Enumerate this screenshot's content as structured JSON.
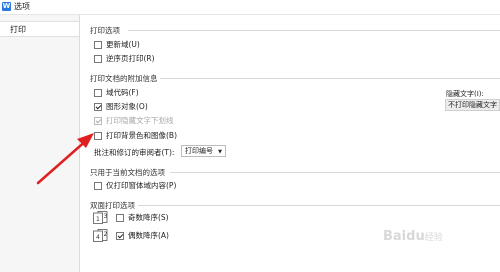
{
  "window": {
    "title": "选项",
    "app_icon": "W"
  },
  "sidebar": {
    "items": [
      {
        "label": "打印"
      }
    ]
  },
  "sections": {
    "print_options": {
      "title": "打印选项",
      "items": [
        {
          "label": "更新域(U)",
          "checked": false
        },
        {
          "label": "逆序页打印(R)",
          "checked": false
        }
      ]
    },
    "attached_info": {
      "title": "打印文档的附加信息",
      "items": [
        {
          "label": "域代码(F)",
          "checked": false,
          "disabled": false
        },
        {
          "label": "图形对象(O)",
          "checked": true,
          "disabled": false
        },
        {
          "label": "打印隐藏文字下划线",
          "checked": true,
          "disabled": true
        },
        {
          "label": "打印背景色和图像(B)",
          "checked": false,
          "disabled": false
        }
      ],
      "hidden_text_label": "隐藏文字(I):",
      "hidden_text_value": "不打印隐藏文字",
      "reviewer_label": "批注和修订的审阅者(T):",
      "reviewer_value": "打印编号"
    },
    "current_doc": {
      "title": "只用于当前文档的选项",
      "items": [
        {
          "label": "仅打印窗体域内容(P)",
          "checked": false
        }
      ]
    },
    "duplex": {
      "title": "双面打印选项",
      "items": [
        {
          "label": "奇数降序(S)",
          "checked": false,
          "icon_pages": "1 3"
        },
        {
          "label": "偶数降序(A)",
          "checked": true,
          "icon_pages": "4 2"
        }
      ]
    }
  },
  "watermark": {
    "text": "Baidu",
    "sub": "经验"
  },
  "colors": {
    "accent": "#2b79e0",
    "arrow": "#e02020"
  }
}
